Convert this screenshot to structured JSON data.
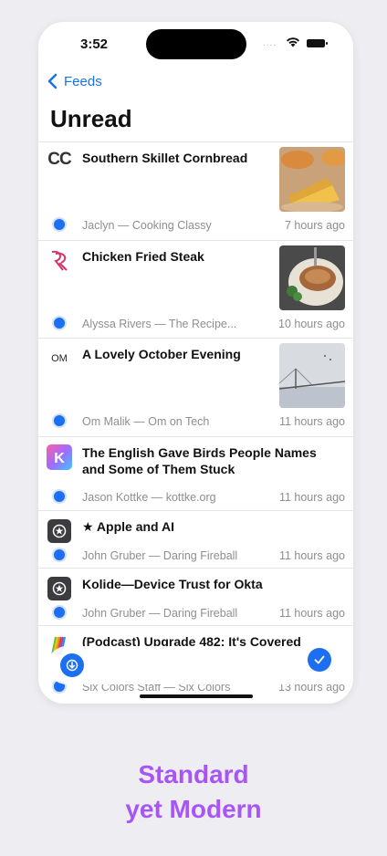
{
  "status": {
    "time": "3:52",
    "signal": "....",
    "wifi_icon": "wifi-icon",
    "battery_icon": "battery-icon"
  },
  "nav": {
    "back_label": "Feeds",
    "title": "Unread"
  },
  "articles": [
    {
      "title": "Southern Skillet Cornbread",
      "meta": "Jaclyn — Cooking Classy",
      "time": "7 hours ago",
      "logo": "CC",
      "thumb": "cornbread"
    },
    {
      "title": "Chicken Fried Steak",
      "meta": "Alyssa Rivers — The Recipe...",
      "time": "10 hours ago",
      "logo": "recipe-critic-logo",
      "thumb": "steak"
    },
    {
      "title": "A Lovely October Evening",
      "meta": "Om Malik — Om on Tech",
      "time": "11 hours ago",
      "logo": "OM",
      "thumb": "bridge"
    },
    {
      "title": "The English Gave Birds People Names and Some of Them Stuck",
      "meta": "Jason Kottke — kottke.org",
      "time": "11 hours ago",
      "logo": "kottke-logo"
    },
    {
      "title": "★ Apple and AI",
      "meta": "John Gruber — Daring Fireball",
      "time": "11 hours ago",
      "logo": "star-icon"
    },
    {
      "title": "Kolide—Device Trust for Okta",
      "meta": "John Gruber — Daring Fireball",
      "time": "11 hours ago",
      "logo": "star-icon"
    },
    {
      "title": "(Podcast) Upgrade 482: It's Covered",
      "meta": "Six Colors Staff — Six Colors",
      "time": "13 hours ago",
      "logo": "six-colors-logo"
    }
  ],
  "toolbar": {
    "left_icon": "arrow-down-icon",
    "right_icon": "checkmark-icon"
  },
  "tagline": {
    "line1": "Standard",
    "line2": "yet Modern"
  },
  "colors": {
    "accent": "#1d6ff2",
    "tagline": "#a855f7"
  }
}
